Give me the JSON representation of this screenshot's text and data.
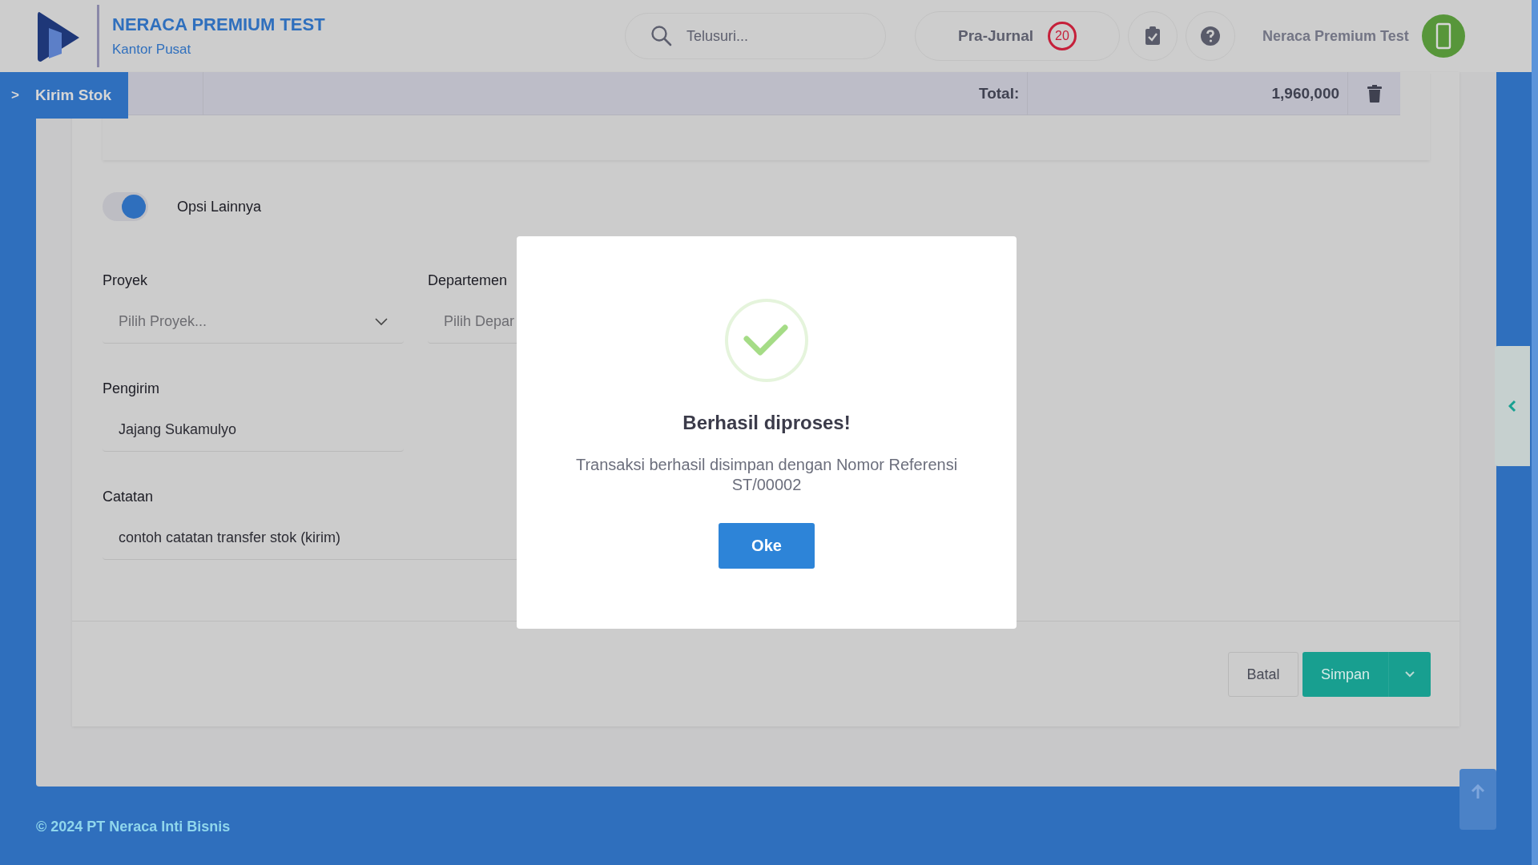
{
  "header": {
    "brand_title": "NERACA PREMIUM TEST",
    "branch": "Kantor Pusat",
    "search": {
      "placeholder": "Telusuri..."
    },
    "pra_jurnal": {
      "label": "Pra-Jurnal",
      "badge": "20"
    },
    "user_name": "Neraca Premium Test"
  },
  "breadcrumb": {
    "icon": ">",
    "label": "Kirim Stok"
  },
  "table_total": {
    "label": "Total:",
    "value": "1,960,000"
  },
  "toggle": {
    "label": "Opsi Lainnya",
    "on": true
  },
  "fields": [
    {
      "label": "Proyek",
      "placeholder": "Pilih Proyek...",
      "kind": "select"
    },
    {
      "label": "Departemen",
      "placeholder": "Pilih Depar",
      "kind": "text"
    },
    {
      "label": "Pengirim",
      "value": "Jajang Sukamulyo",
      "kind": "text"
    },
    {
      "label": "Catatan",
      "value": "contoh catatan transfer stok (kirim)",
      "kind": "text"
    }
  ],
  "actions": [
    {
      "label": "Batal",
      "kind": "plain"
    },
    {
      "label": "Simpan",
      "kind": "split"
    }
  ],
  "footer": "© 2024 PT Neraca Inti Bisnis",
  "modal": {
    "title": "Berhasil diproses!",
    "message": "Transaksi berhasil disimpan dengan Nomor Referensi ST/00002",
    "button": "Oke"
  }
}
